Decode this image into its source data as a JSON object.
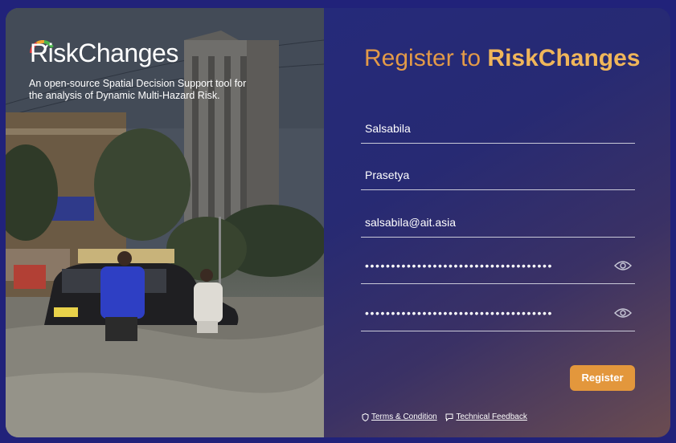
{
  "brand": {
    "logo_text": "RiskChanges",
    "tagline": "An open-source Spatial Decision Support tool for the analysis of Dynamic Multi-Hazard Risk."
  },
  "form": {
    "title_prefix": "Register to ",
    "title_brand": "RiskChanges",
    "first_name": "Salsabila",
    "last_name": "Prasetya",
    "email": "salsabila@ait.asia",
    "password_masked": "••••••••••••••••••••••••••••••••••••",
    "confirm_password_masked": "••••••••••••••••••••••••••••••••••••",
    "register_label": "Register"
  },
  "footer": {
    "terms_label": "Terms & Condition",
    "feedback_label": "Technical Feedback"
  },
  "colors": {
    "accent": "#e3973c",
    "panel": "#252a7a",
    "page_bg": "#21227a"
  },
  "icons": [
    "logo-gauge-icon",
    "eye-icon",
    "shield-icon",
    "chat-icon"
  ]
}
